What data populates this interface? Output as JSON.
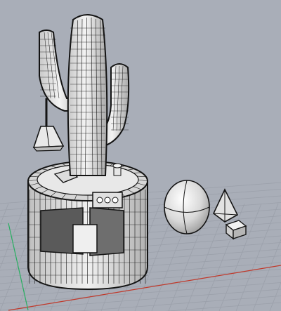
{
  "viewport": {
    "projection": "perspective",
    "display_mode": "shaded-with-wireframe",
    "colors": {
      "background": "#a9aeb8",
      "grid_line": "#9ba0aa",
      "x_axis": "#c0392b",
      "y_axis": "#27ae60",
      "model_fill": "#f2f2f2",
      "model_shade": "#bdbdbd",
      "wire": "#141414"
    }
  },
  "scene": {
    "objects": [
      {
        "name": "cactus-main-stem"
      },
      {
        "name": "cactus-left-arm"
      },
      {
        "name": "cactus-right-arm"
      },
      {
        "name": "cylinder-pot"
      },
      {
        "name": "lamp-pyramid"
      },
      {
        "name": "sphere"
      },
      {
        "name": "cone-pyramid"
      },
      {
        "name": "cube"
      }
    ]
  }
}
